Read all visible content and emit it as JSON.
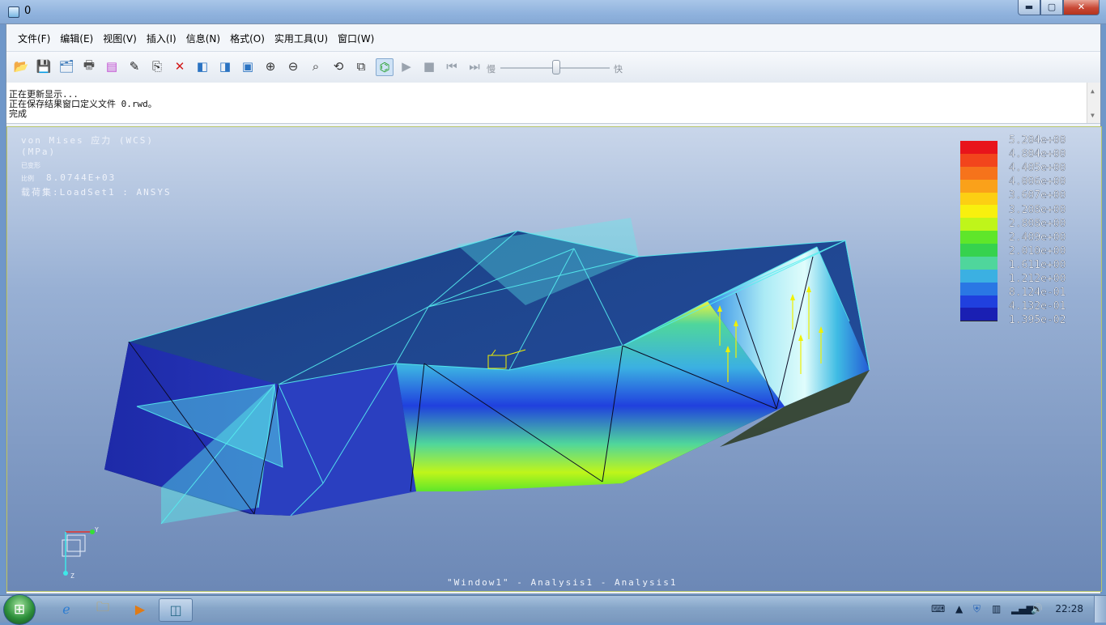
{
  "window": {
    "title": "0",
    "minimize_label": "▬",
    "maximize_label": "▢",
    "close_label": "✕"
  },
  "menu": [
    "文件(F)",
    "编辑(E)",
    "视图(V)",
    "插入(I)",
    "信息(N)",
    "格式(O)",
    "实用工具(U)",
    "窗口(W)"
  ],
  "toolbar": {
    "icons": [
      "open-folder-icon",
      "save-icon",
      "save-as-icon",
      "print-icon",
      "rainbow-icon",
      "edit-definition-icon",
      "copy-icon",
      "delete-icon",
      "show-icon",
      "hide-icon",
      "format-icon",
      "zoom-in-icon",
      "zoom-out-icon",
      "refit-icon",
      "spin-icon",
      "label-icon",
      "query-icon",
      "play-icon",
      "stop-icon",
      "step-back-icon",
      "step-forward-icon"
    ],
    "speed_slow": "慢",
    "speed_fast": "快",
    "speed_value": 0.5
  },
  "messages": [
    "正在更新显示...",
    "正在保存结果窗口定义文件 0.rwd。",
    "完成"
  ],
  "viewport": {
    "quantity": "von Mises 应力 (WCS)",
    "units": "(MPa)",
    "deformed_label": "已变形",
    "scale_label": "比例",
    "scale_value": "8.0744E+03",
    "loadset": "载荷集:LoadSet1 :  ANSYS",
    "footer": "\"Window1\" - Analysis1 - Analysis1",
    "axis_y": "Y",
    "axis_z": "Z"
  },
  "legend": {
    "values": [
      "5.204e+00",
      "4.804e+00",
      "4.405e+00",
      "4.006e+00",
      "3.607e+00",
      "3.208e+00",
      "2.808e+00",
      "2.409e+00",
      "2.010e+00",
      "1.611e+00",
      "1.212e+00",
      "8.124e-01",
      "4.132e-01",
      "1.395e-02"
    ],
    "colors": [
      "#e8141b",
      "#f2451c",
      "#f6731b",
      "#faa11a",
      "#fccf13",
      "#f8f00e",
      "#bff51a",
      "#5fe62a",
      "#36d24e",
      "#4fd69c",
      "#3bb0e2",
      "#2a77e4",
      "#2040de",
      "#1a1fb3"
    ]
  },
  "taskbar": {
    "items": [
      "ie-icon",
      "explorer-icon",
      "media-player-icon",
      "creo-simulate-icon"
    ],
    "clock": "22:28",
    "tray_icons": [
      "keyboard-icon",
      "show-hidden-icon",
      "security-icon",
      "network-device-icon",
      "signal-icon",
      "volume-icon"
    ]
  }
}
